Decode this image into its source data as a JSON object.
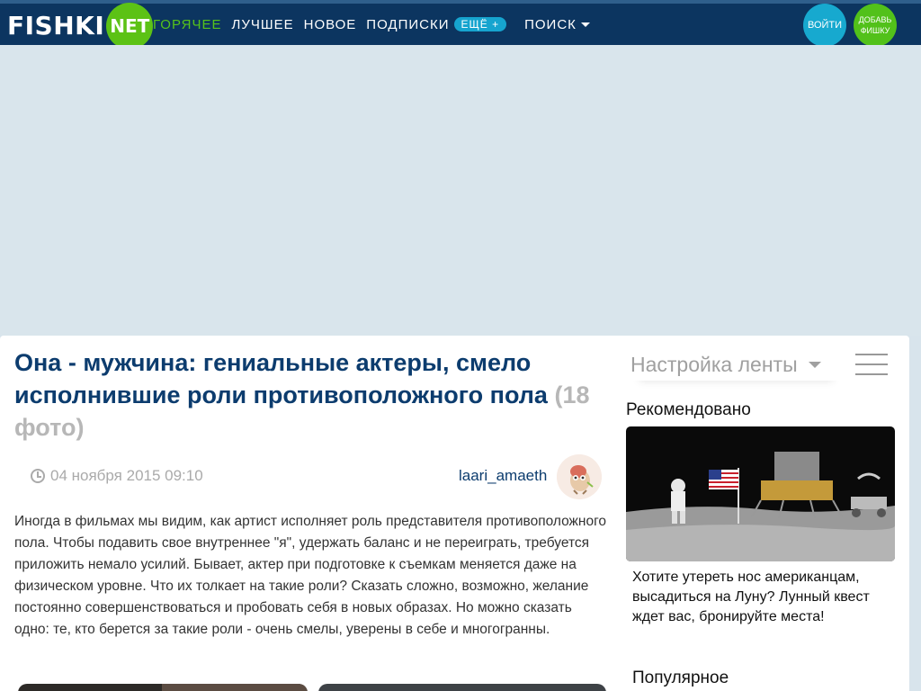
{
  "header": {
    "logo_text": "FISHKI",
    "logo_circle": "NET",
    "nav": [
      {
        "label": "ГОРЯЧЕЕ",
        "active": true
      },
      {
        "label": "ЛУЧШЕЕ"
      },
      {
        "label": "НОВОЕ"
      },
      {
        "label": "ПОДПИСКИ"
      }
    ],
    "more_label": "ЕЩЁ +",
    "search_label": "ПОИСК",
    "login_label": "ВОЙТИ",
    "add_label": "ДОБАВЬ ФИШКУ"
  },
  "article": {
    "title": "Она - мужчина: гениальные актеры, смело исполнившие роли противоположного пола",
    "photo_count": "(18 фото)",
    "date": "04 ноября 2015 09:10",
    "author": "laari_amaeth",
    "body": "Иногда в фильмах мы видим, как артист исполняет роль представителя противоположного пола. Чтобы подавить свое внутреннее \"я\", удержать баланс и не переиграть, требуется приложить немало усилий. Бывает, актер при подготовке к съемкам меняется даже на физическом уровне. Что их толкает на такие роли? Сказать сложно, возможно, желание постоянно совершенствоваться и пробовать себя в новых образах. Но можно сказать одно: те, кто берется за такие роли - очень смелы, уверены в себе и многогранны."
  },
  "sidebar": {
    "feed_settings": "Настройка ленты",
    "recommended_title": "Рекомендовано",
    "recommended_text": "Хотите утереть нос американцам, высадиться на Луну? Лунный квест ждет вас, бронируйте места!",
    "popular_title": "Популярное"
  },
  "colors": {
    "header_bg": "#0c3560",
    "accent_green": "#5cc215",
    "accent_blue": "#17a9cf",
    "title_color": "#0c3c6e"
  }
}
